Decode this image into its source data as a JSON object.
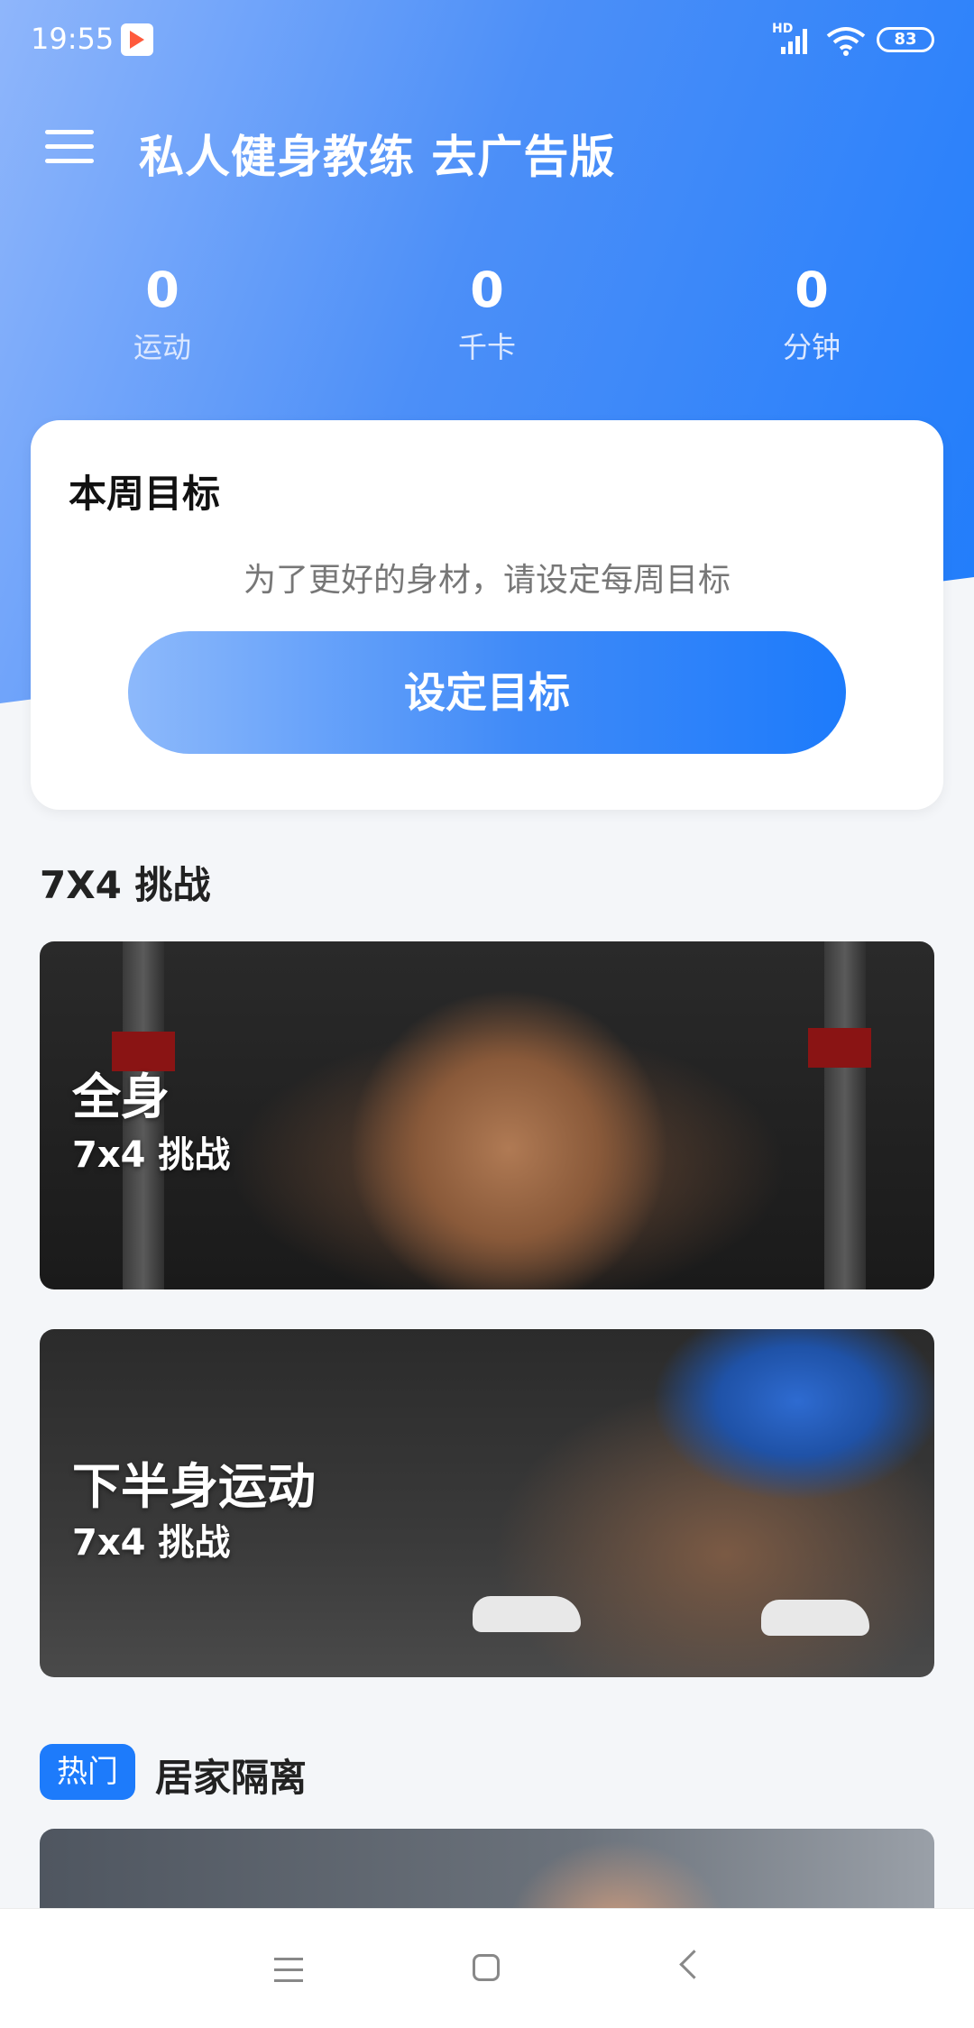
{
  "status_bar": {
    "time": "19:55",
    "network": "HD",
    "battery": "83"
  },
  "app": {
    "title": "私人健身教练 去广告版"
  },
  "stats": [
    {
      "value": "0",
      "label": "运动"
    },
    {
      "value": "0",
      "label": "千卡"
    },
    {
      "value": "0",
      "label": "分钟"
    }
  ],
  "weekly_goal": {
    "title": "本周目标",
    "description": "为了更好的身材，请设定每周目标",
    "button_label": "设定目标"
  },
  "challenge_section": {
    "title": "7X4 挑战",
    "cards": [
      {
        "name": "全身",
        "subtitle": "7x4 挑战"
      },
      {
        "name": "下半身运动",
        "subtitle": "7x4 挑战"
      }
    ]
  },
  "home_section": {
    "badge": "热门",
    "title": "居家隔离"
  },
  "colors": {
    "accent": "#1d7bfb",
    "header_gradient_start": "#8fb6fb",
    "header_gradient_end": "#1f7cfb",
    "background": "#f4f6f9"
  },
  "icons": [
    "menu-icon",
    "signal-icon",
    "wifi-icon",
    "battery-icon",
    "nav-menu-icon",
    "nav-home-icon",
    "nav-back-icon"
  ]
}
